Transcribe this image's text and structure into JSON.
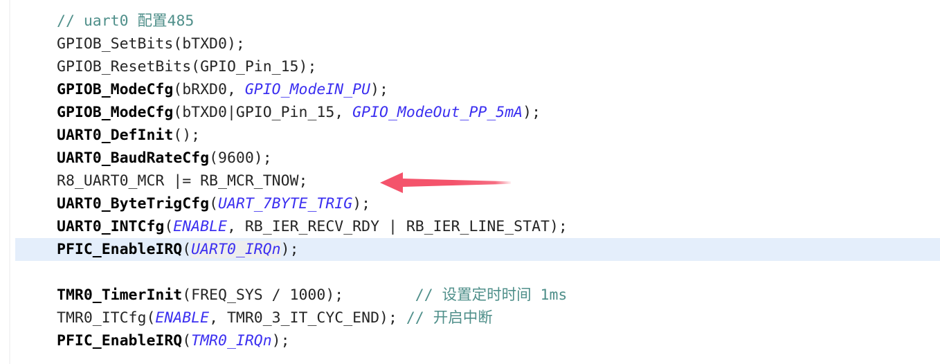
{
  "editor": {
    "background_color": "#ffffff",
    "highlight_line_color": "#e4eefb",
    "selection_color": "#eeeeee",
    "gutter_rule_color": "#f4f4f5",
    "colors": {
      "plain": "#252525",
      "function": "#000000",
      "macro": "#3b2ff0",
      "comment": "#4f8f8a",
      "arrow": "#f4536b"
    }
  },
  "annotation": {
    "arrow_name": "left-pointing-arrow",
    "arrow_color": "#f4536b",
    "arrow_direction": "left",
    "points_at_line": 8
  },
  "code": {
    "lines": [
      {
        "index": 1,
        "highlighted": false,
        "tokens": [
          {
            "t": "// uart0 配置485",
            "c": "comment"
          }
        ]
      },
      {
        "index": 2,
        "highlighted": false,
        "tokens": [
          {
            "t": "GPIOB_SetBits",
            "c": "plain"
          },
          {
            "t": "(bTXD0);",
            "c": "plain"
          }
        ]
      },
      {
        "index": 3,
        "highlighted": false,
        "tokens": [
          {
            "t": "GPIOB_ResetBits",
            "c": "plain"
          },
          {
            "t": "(GPIO_Pin_15);",
            "c": "plain"
          }
        ]
      },
      {
        "index": 4,
        "highlighted": false,
        "tokens": [
          {
            "t": "GPIOB_ModeCfg",
            "c": "function"
          },
          {
            "t": "(bRXD0, ",
            "c": "plain"
          },
          {
            "t": "GPIO_ModeIN_PU",
            "c": "macro"
          },
          {
            "t": ");",
            "c": "plain"
          }
        ]
      },
      {
        "index": 5,
        "highlighted": false,
        "tokens": [
          {
            "t": "GPIOB_ModeCfg",
            "c": "function"
          },
          {
            "t": "(bTXD0|GPIO_Pin_15, ",
            "c": "plain"
          },
          {
            "t": "GPIO_ModeOut_PP_5mA",
            "c": "macro"
          },
          {
            "t": ");",
            "c": "plain"
          }
        ]
      },
      {
        "index": 6,
        "highlighted": false,
        "tokens": [
          {
            "t": "UART0_DefInit",
            "c": "function"
          },
          {
            "t": "();",
            "c": "plain"
          }
        ]
      },
      {
        "index": 7,
        "highlighted": false,
        "tokens": [
          {
            "t": "UART0_BaudRateCfg",
            "c": "function"
          },
          {
            "t": "(9600);",
            "c": "plain"
          }
        ]
      },
      {
        "index": 8,
        "highlighted": false,
        "tokens": [
          {
            "t": "R8_UART0_MCR |= RB_MCR_TNOW;",
            "c": "plain"
          }
        ]
      },
      {
        "index": 9,
        "highlighted": false,
        "tokens": [
          {
            "t": "UART0_ByteTrigCfg",
            "c": "function"
          },
          {
            "t": "(",
            "c": "plain"
          },
          {
            "t": "UART_7BYTE_TRIG",
            "c": "macro"
          },
          {
            "t": ");",
            "c": "plain"
          }
        ]
      },
      {
        "index": 10,
        "highlighted": false,
        "tokens": [
          {
            "t": "UART0_INTCfg",
            "c": "function"
          },
          {
            "t": "(",
            "c": "plain"
          },
          {
            "t": "ENABLE",
            "c": "macro"
          },
          {
            "t": ", RB_IER_RECV_RDY | RB_IER_LINE_STAT);",
            "c": "plain"
          }
        ]
      },
      {
        "index": 11,
        "highlighted": true,
        "tokens": [
          {
            "t": "PFIC_EnableIRQ",
            "c": "function"
          },
          {
            "t": "(",
            "c": "plain"
          },
          {
            "t": "UART0_IRQn",
            "c": "macro",
            "sel": true
          },
          {
            "t": ");",
            "c": "plain"
          }
        ]
      },
      {
        "index": 12,
        "highlighted": false,
        "tokens": []
      },
      {
        "index": 13,
        "highlighted": false,
        "tokens": [
          {
            "t": "TMR0_TimerInit",
            "c": "function"
          },
          {
            "t": "(FREQ_SYS / 1000);        ",
            "c": "plain"
          },
          {
            "t": "// 设置定时时间 1ms",
            "c": "comment"
          }
        ]
      },
      {
        "index": 14,
        "highlighted": false,
        "tokens": [
          {
            "t": "TMR0_ITCfg",
            "c": "plain"
          },
          {
            "t": "(",
            "c": "plain"
          },
          {
            "t": "ENABLE",
            "c": "macro"
          },
          {
            "t": ", TMR0_3_IT_CYC_END); ",
            "c": "plain"
          },
          {
            "t": "// 开启中断",
            "c": "comment"
          }
        ]
      },
      {
        "index": 15,
        "highlighted": false,
        "tokens": [
          {
            "t": "PFIC_EnableIRQ",
            "c": "function"
          },
          {
            "t": "(",
            "c": "plain"
          },
          {
            "t": "TMR0_IRQn",
            "c": "macro"
          },
          {
            "t": ");",
            "c": "plain"
          }
        ]
      }
    ]
  }
}
